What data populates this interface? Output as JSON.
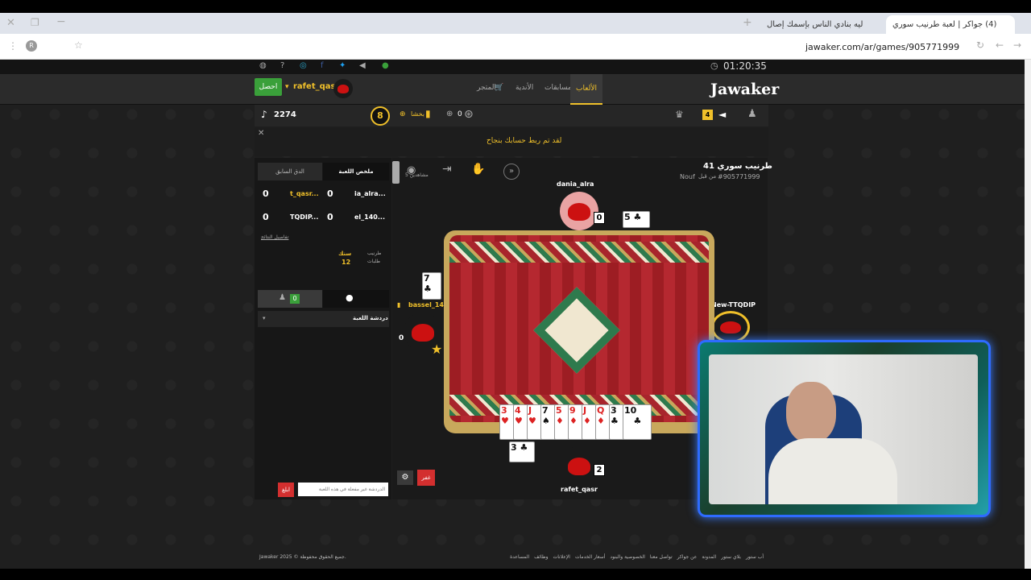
{
  "browser": {
    "tabs": [
      {
        "title": "(4) جواكر | لعبة طرنيب سوري",
        "active": true
      },
      {
        "title": "ليه بنادي الناس بإسمك إصال",
        "active": false
      }
    ],
    "url": "jawaker.com/ar/games/905771999"
  },
  "site": {
    "clock": "01:20:35",
    "logo": "Jawaker",
    "nav": [
      "الألعاب",
      "مسابقات",
      "الأندية",
      "المتجر"
    ],
    "username": "rafet_qasr",
    "get_button": "احصل",
    "balance": "2274",
    "level": "8",
    "coins": "0",
    "vip": "بخشا",
    "notify_count": "4",
    "banner": "لقد تم ربط حسابك بنجاح",
    "colors": {
      "accent": "#f0c02a",
      "green": "#3aa03a",
      "red": "#d32f2f"
    }
  },
  "panel": {
    "tabs": [
      "ملخص اللعبة",
      "الدق السابق"
    ],
    "scores": [
      {
        "p1": "ia_alra...",
        "v1": "0",
        "p2": "t_qasr...",
        "v2": "0"
      },
      {
        "p1": "el_140...",
        "v1": "0",
        "p2": "TQDIP...",
        "v2": "0"
      }
    ],
    "details_link": "تفاصيل النتائج",
    "mode_label": "طرنيب",
    "mode_value": "سنك",
    "requests_label": "طلبات",
    "requests_value": "12",
    "online_count": "0",
    "chat_title": "دردشة اللعبة",
    "chat_placeholder": "الدردشة غير مفعلة في هذه اللعبة",
    "send_button": "ابلغ"
  },
  "game": {
    "title": "طرنيب سوري 41",
    "game_id": "#905771999",
    "host": "Nouf",
    "host_prefix": "من قبل",
    "spectators": "5 مشاهدين",
    "players": {
      "top": {
        "name": "dania_alra",
        "score": "0"
      },
      "left": {
        "name": "bassel_140",
        "score": "0"
      },
      "right": {
        "name": "New-TTQDIP"
      },
      "bottom": {
        "name": "rafet_qasr",
        "score": "2"
      }
    },
    "played": {
      "top": "5",
      "left": "7",
      "bottom": "3"
    },
    "hand": [
      {
        "rank": "3",
        "color": "red"
      },
      {
        "rank": "4",
        "color": "red"
      },
      {
        "rank": "J",
        "color": "red"
      },
      {
        "rank": "7",
        "color": "blk"
      },
      {
        "rank": "5",
        "color": "red"
      },
      {
        "rank": "9",
        "color": "red"
      },
      {
        "rank": "J",
        "color": "red"
      },
      {
        "rank": "Q",
        "color": "red"
      },
      {
        "rank": "3",
        "color": "blk"
      },
      {
        "rank": "10",
        "color": "blk"
      }
    ],
    "forfeit_button": "غفر"
  },
  "footer": {
    "copyright": "Jawaker 2025 © جميع الحقوق محفوظة.",
    "links": [
      "أب ستور",
      "بلاي ستور",
      "المدونة",
      "عن جواكر",
      "تواصل معنا",
      "الخصوصية والبنود",
      "أسعار الخدمات",
      "الإعلانات",
      "وظائف",
      "المساعدة"
    ]
  }
}
